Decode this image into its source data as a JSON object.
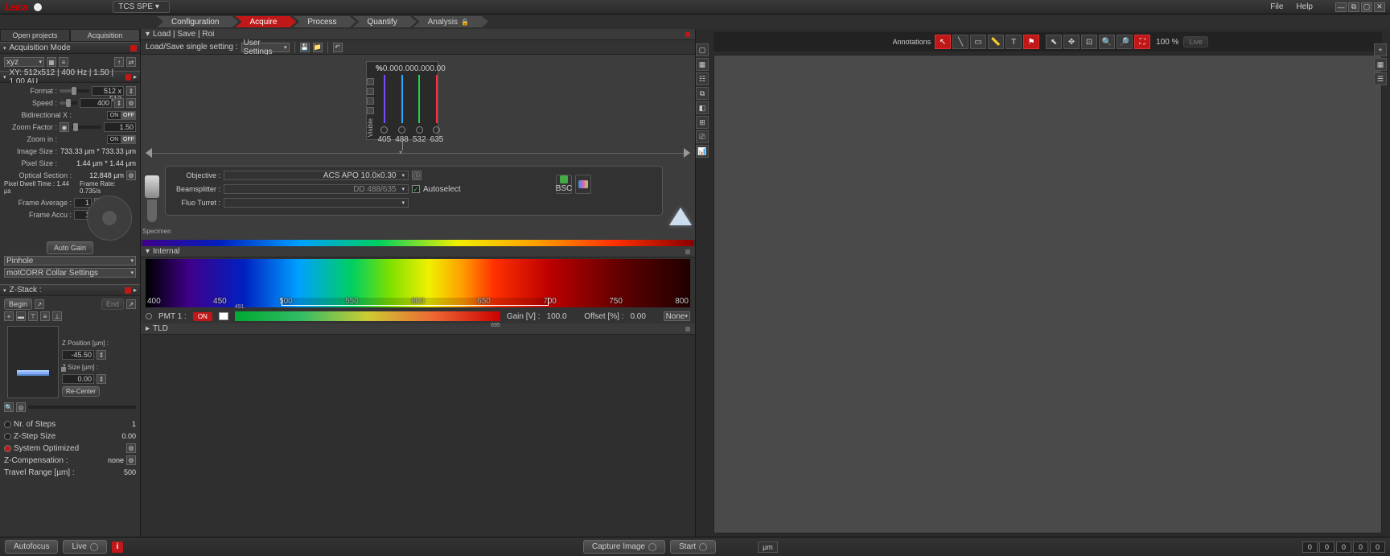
{
  "top": {
    "logo": "Leica",
    "system": "TCS SPE",
    "menus": {
      "file": "File",
      "help": "Help"
    }
  },
  "nav": {
    "steps": [
      "Configuration",
      "Acquire",
      "Process",
      "Quantify",
      "Analysis"
    ],
    "active": 1
  },
  "left_tabs": {
    "open_projects": "Open projects",
    "acquisition": "Acquisition"
  },
  "acq_mode": {
    "header": "Acquisition Mode",
    "mode": "xyz"
  },
  "xy_panel": {
    "header": "XY: 512x512 | 400 Hz | 1.50 | 1.00 AU",
    "format_label": "Format :",
    "format_value": "512 x 512",
    "speed_label": "Speed :",
    "speed_value": "400",
    "bidir_label": "Bidirectional X :",
    "zoom_label": "Zoom Factor :",
    "zoom_value": "1.50",
    "zoomin_label": "Zoom in :",
    "imgsize_label": "Image Size :",
    "imgsize_value": "733.33 µm * 733.33 µm",
    "pixelsize_label": "Pixel Size :",
    "pixelsize_value": "1.44 µm * 1.44 µm",
    "optsec_label": "Optical Section :",
    "optsec_value": "12.848 µm",
    "dwell_label": "Pixel Dwell Time : 1.44 µs",
    "framerate_label": "Frame Rate: 0.735/s",
    "frameavg_label": "Frame Average :",
    "frameavg_value": "1",
    "frameaccu_label": "Frame Accu :",
    "frameaccu_value": "1",
    "autogain": "Auto Gain",
    "pinhole": "Pinhole",
    "motcorr": "motCORR Collar Settings"
  },
  "zstack": {
    "header": "Z-Stack :",
    "begin": "Begin",
    "end": "End",
    "zpos_label": "Z Position [µm] :",
    "zpos_value": "-45.50",
    "zsize_label": "Z Size [µm] :",
    "zsize_value": "0.00",
    "recenter": "Re-Center",
    "nsteps_label": "Nr. of Steps",
    "nsteps_value": "1",
    "stepsize_label": "Z-Step Size",
    "stepsize_value": "0.00",
    "sysopt_label": "System Optimized",
    "zcomp_label": "Z-Compensation :",
    "zcomp_value": "none",
    "travel_label": "Travel Range [µm] :",
    "travel_value": "500"
  },
  "center": {
    "load_header": "Load | Save | Roi",
    "load_label": "Load/Save single setting :",
    "load_combo": "User Settings",
    "visible": {
      "pct_label": "%",
      "percents": [
        "0.00",
        "0.00",
        "0.00",
        "0.00"
      ],
      "wavelengths": [
        "405",
        "488",
        "532",
        "635"
      ],
      "colors": [
        "#7a4aff",
        "#2aa8ff",
        "#20d040",
        "#ff3040"
      ],
      "label": "Visible"
    },
    "objective_label": "Objective :",
    "objective_value": "ACS APO  10.0x0.30",
    "beamsplitter_label": "Beamsplitter :",
    "beamsplitter_value": "DD 488/635",
    "autoselect": "Autoselect",
    "fluoturret_label": "Fluo Turret :",
    "bsc": "BSC",
    "specimen": "Specimen",
    "internal_hd": "Internal",
    "spectrum_ticks": [
      "400",
      "450",
      "500",
      "550",
      "600",
      "650",
      "700",
      "750",
      "800"
    ],
    "pmt": {
      "name": "PMT 1 :",
      "on": "ON",
      "gain_label": "Gain [V] :",
      "gain_value": "100.0",
      "offset_label": "Offset [%] :",
      "offset_value": "0.00",
      "range_lo": "491",
      "range_hi": "695",
      "lut": "None"
    },
    "tld_hd": "TLD"
  },
  "right": {
    "annotations": "Annotations",
    "zoom": "100 %",
    "live": "Live"
  },
  "bottom": {
    "autofocus": "Autofocus",
    "live": "Live",
    "capture": "Capture Image",
    "start": "Start",
    "unit": "µm",
    "coords": [
      "0",
      "0",
      "0",
      "0",
      "0"
    ]
  }
}
